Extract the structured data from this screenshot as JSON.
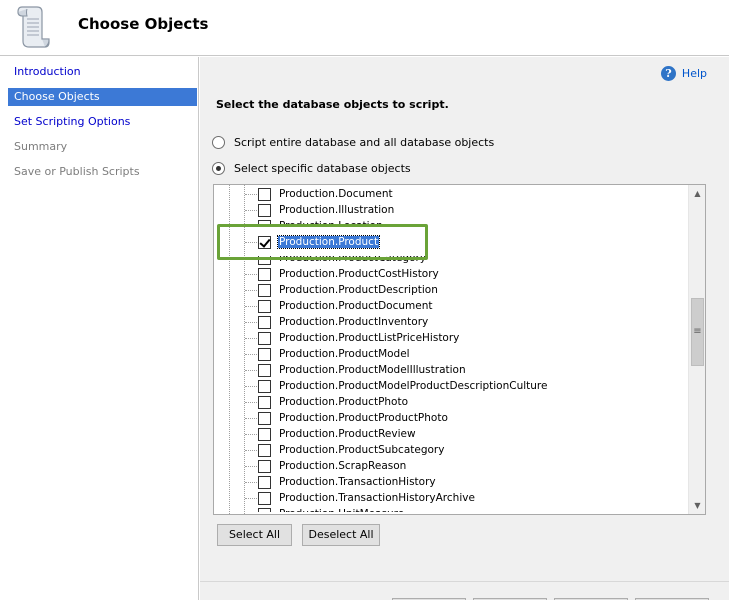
{
  "header": {
    "title": "Choose Objects",
    "icon": "scroll-icon"
  },
  "nav": {
    "items": [
      {
        "label": "Introduction",
        "state": "link"
      },
      {
        "label": "Choose Objects",
        "state": "selected"
      },
      {
        "label": "Set Scripting Options",
        "state": "link"
      },
      {
        "label": "Summary",
        "state": "disabled"
      },
      {
        "label": "Save or Publish Scripts",
        "state": "disabled"
      }
    ]
  },
  "help": {
    "label": "Help"
  },
  "main": {
    "instruction": "Select the database objects to script.",
    "radio_entire": "Script entire database and all database objects",
    "radio_specific": "Select specific database objects",
    "selected_option": "specific"
  },
  "tree": {
    "partial_top": "Production.Location",
    "partial_top2": "Production.ProductCategory",
    "items": [
      {
        "label": "Production.Document",
        "checked": false
      },
      {
        "label": "Production.Illustration",
        "checked": false
      },
      {
        "label": "Production.Product",
        "checked": true
      },
      {
        "label": "Production.ProductCostHistory",
        "checked": false
      },
      {
        "label": "Production.ProductDescription",
        "checked": false
      },
      {
        "label": "Production.ProductDocument",
        "checked": false
      },
      {
        "label": "Production.ProductInventory",
        "checked": false
      },
      {
        "label": "Production.ProductListPriceHistory",
        "checked": false
      },
      {
        "label": "Production.ProductModel",
        "checked": false
      },
      {
        "label": "Production.ProductModelIllustration",
        "checked": false
      },
      {
        "label": "Production.ProductModelProductDescriptionCulture",
        "checked": false
      },
      {
        "label": "Production.ProductPhoto",
        "checked": false
      },
      {
        "label": "Production.ProductProductPhoto",
        "checked": false
      },
      {
        "label": "Production.ProductReview",
        "checked": false
      },
      {
        "label": "Production.ProductSubcategory",
        "checked": false
      },
      {
        "label": "Production.ScrapReason",
        "checked": false
      },
      {
        "label": "Production.TransactionHistory",
        "checked": false
      },
      {
        "label": "Production.TransactionHistoryArchive",
        "checked": false
      }
    ],
    "partial_bottom": "Production.UnitMeasure"
  },
  "buttons": {
    "select_all": "Select All",
    "deselect_all": "Deselect All"
  },
  "colors": {
    "selection": "#3c79d6",
    "callout": "#6aa338",
    "link": "#0000cc"
  }
}
